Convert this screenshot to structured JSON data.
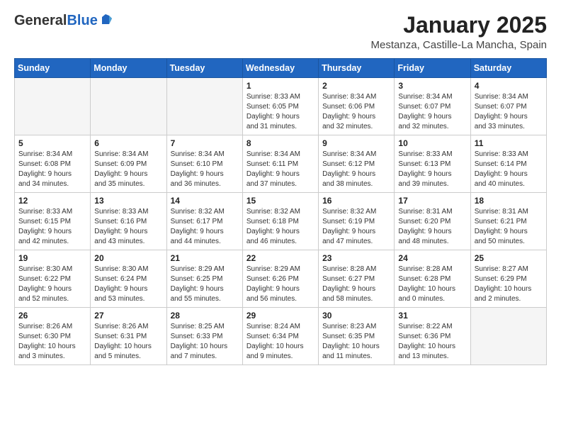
{
  "header": {
    "logo_general": "General",
    "logo_blue": "Blue",
    "title": "January 2025",
    "subtitle": "Mestanza, Castille-La Mancha, Spain"
  },
  "days_of_week": [
    "Sunday",
    "Monday",
    "Tuesday",
    "Wednesday",
    "Thursday",
    "Friday",
    "Saturday"
  ],
  "weeks": [
    [
      {
        "day": "",
        "info": ""
      },
      {
        "day": "",
        "info": ""
      },
      {
        "day": "",
        "info": ""
      },
      {
        "day": "1",
        "info": "Sunrise: 8:33 AM\nSunset: 6:05 PM\nDaylight: 9 hours\nand 31 minutes."
      },
      {
        "day": "2",
        "info": "Sunrise: 8:34 AM\nSunset: 6:06 PM\nDaylight: 9 hours\nand 32 minutes."
      },
      {
        "day": "3",
        "info": "Sunrise: 8:34 AM\nSunset: 6:07 PM\nDaylight: 9 hours\nand 32 minutes."
      },
      {
        "day": "4",
        "info": "Sunrise: 8:34 AM\nSunset: 6:07 PM\nDaylight: 9 hours\nand 33 minutes."
      }
    ],
    [
      {
        "day": "5",
        "info": "Sunrise: 8:34 AM\nSunset: 6:08 PM\nDaylight: 9 hours\nand 34 minutes."
      },
      {
        "day": "6",
        "info": "Sunrise: 8:34 AM\nSunset: 6:09 PM\nDaylight: 9 hours\nand 35 minutes."
      },
      {
        "day": "7",
        "info": "Sunrise: 8:34 AM\nSunset: 6:10 PM\nDaylight: 9 hours\nand 36 minutes."
      },
      {
        "day": "8",
        "info": "Sunrise: 8:34 AM\nSunset: 6:11 PM\nDaylight: 9 hours\nand 37 minutes."
      },
      {
        "day": "9",
        "info": "Sunrise: 8:34 AM\nSunset: 6:12 PM\nDaylight: 9 hours\nand 38 minutes."
      },
      {
        "day": "10",
        "info": "Sunrise: 8:33 AM\nSunset: 6:13 PM\nDaylight: 9 hours\nand 39 minutes."
      },
      {
        "day": "11",
        "info": "Sunrise: 8:33 AM\nSunset: 6:14 PM\nDaylight: 9 hours\nand 40 minutes."
      }
    ],
    [
      {
        "day": "12",
        "info": "Sunrise: 8:33 AM\nSunset: 6:15 PM\nDaylight: 9 hours\nand 42 minutes."
      },
      {
        "day": "13",
        "info": "Sunrise: 8:33 AM\nSunset: 6:16 PM\nDaylight: 9 hours\nand 43 minutes."
      },
      {
        "day": "14",
        "info": "Sunrise: 8:32 AM\nSunset: 6:17 PM\nDaylight: 9 hours\nand 44 minutes."
      },
      {
        "day": "15",
        "info": "Sunrise: 8:32 AM\nSunset: 6:18 PM\nDaylight: 9 hours\nand 46 minutes."
      },
      {
        "day": "16",
        "info": "Sunrise: 8:32 AM\nSunset: 6:19 PM\nDaylight: 9 hours\nand 47 minutes."
      },
      {
        "day": "17",
        "info": "Sunrise: 8:31 AM\nSunset: 6:20 PM\nDaylight: 9 hours\nand 48 minutes."
      },
      {
        "day": "18",
        "info": "Sunrise: 8:31 AM\nSunset: 6:21 PM\nDaylight: 9 hours\nand 50 minutes."
      }
    ],
    [
      {
        "day": "19",
        "info": "Sunrise: 8:30 AM\nSunset: 6:22 PM\nDaylight: 9 hours\nand 52 minutes."
      },
      {
        "day": "20",
        "info": "Sunrise: 8:30 AM\nSunset: 6:24 PM\nDaylight: 9 hours\nand 53 minutes."
      },
      {
        "day": "21",
        "info": "Sunrise: 8:29 AM\nSunset: 6:25 PM\nDaylight: 9 hours\nand 55 minutes."
      },
      {
        "day": "22",
        "info": "Sunrise: 8:29 AM\nSunset: 6:26 PM\nDaylight: 9 hours\nand 56 minutes."
      },
      {
        "day": "23",
        "info": "Sunrise: 8:28 AM\nSunset: 6:27 PM\nDaylight: 9 hours\nand 58 minutes."
      },
      {
        "day": "24",
        "info": "Sunrise: 8:28 AM\nSunset: 6:28 PM\nDaylight: 10 hours\nand 0 minutes."
      },
      {
        "day": "25",
        "info": "Sunrise: 8:27 AM\nSunset: 6:29 PM\nDaylight: 10 hours\nand 2 minutes."
      }
    ],
    [
      {
        "day": "26",
        "info": "Sunrise: 8:26 AM\nSunset: 6:30 PM\nDaylight: 10 hours\nand 3 minutes."
      },
      {
        "day": "27",
        "info": "Sunrise: 8:26 AM\nSunset: 6:31 PM\nDaylight: 10 hours\nand 5 minutes."
      },
      {
        "day": "28",
        "info": "Sunrise: 8:25 AM\nSunset: 6:33 PM\nDaylight: 10 hours\nand 7 minutes."
      },
      {
        "day": "29",
        "info": "Sunrise: 8:24 AM\nSunset: 6:34 PM\nDaylight: 10 hours\nand 9 minutes."
      },
      {
        "day": "30",
        "info": "Sunrise: 8:23 AM\nSunset: 6:35 PM\nDaylight: 10 hours\nand 11 minutes."
      },
      {
        "day": "31",
        "info": "Sunrise: 8:22 AM\nSunset: 6:36 PM\nDaylight: 10 hours\nand 13 minutes."
      },
      {
        "day": "",
        "info": ""
      }
    ]
  ]
}
